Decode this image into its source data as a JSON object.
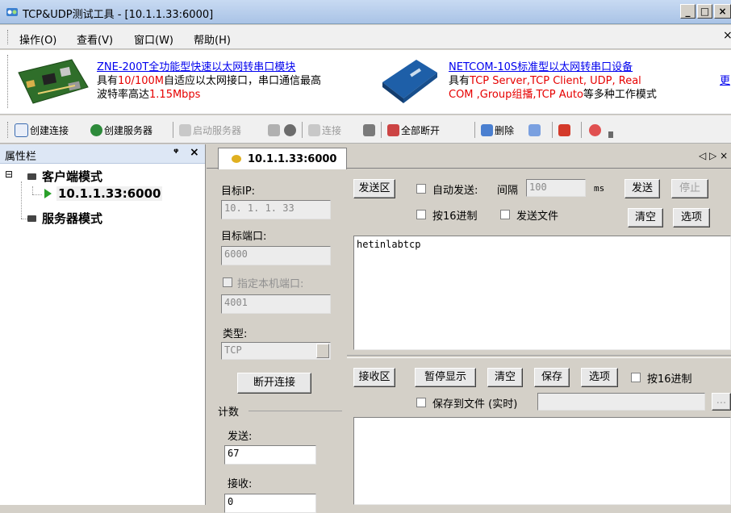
{
  "window": {
    "title": "TCP&UDP测试工具 - [10.1.1.33:6000]",
    "min_label": "_",
    "max_label": "□",
    "close_label": "×"
  },
  "menu": {
    "items": [
      "操作(O)",
      "查看(V)",
      "窗口(W)",
      "帮助(H)"
    ],
    "close_label": "×"
  },
  "ads": {
    "left": {
      "icon": "circuit-board-icon",
      "line1": "ZNE-200T全功能型快速以太网转串口模块",
      "line2_a": "具有",
      "line2_b": "10/100M",
      "line2_c": "自适应以太网接口，串口通信最高",
      "line3_a": "波特率高达",
      "line3_b": "1.15Mbps"
    },
    "right": {
      "icon": "serial-server-device-icon",
      "line1": "NETCOM-10S标准型以太网转串口设备",
      "line2_a": "具有",
      "line2_b": "TCP Server,TCP Client, UDP, Real",
      "line3_a": "COM ,Group组播,TCP Auto",
      "line3_b": "等多种工作模式"
    },
    "more_label": "更"
  },
  "toolbar": {
    "create_connection": "创建连接",
    "create_server": "创建服务器",
    "start_server": "启动服务器",
    "connect": "连接",
    "disconnect_all": "全部断开",
    "delete": "删除",
    "icons": [
      "new-connection-icon",
      "globe-server-icon",
      "start-server-icon",
      "server-icon",
      "stop-circle-icon",
      "connect-icon",
      "disconnect-icon",
      "disconnect-all-icon",
      "delete-icon",
      "settings-icon",
      "record-icon",
      "help-icon"
    ],
    "colors": {
      "accent_blue": "#1f5fbf",
      "delete_red": "#d43a2a"
    }
  },
  "properties": {
    "title": "属性栏",
    "pin_label": "ᵠ",
    "close_label": "×",
    "tree": {
      "client_mode": "客户端模式",
      "client_item": "10.1.1.33:6000",
      "server_mode": "服务器模式",
      "expander": "⊟"
    }
  },
  "tab": {
    "label": "10.1.1.33:6000",
    "nav_label": "◁ ▷ ×"
  },
  "config": {
    "target_ip_label": "目标IP:",
    "target_ip_value": "10. 1. 1. 33",
    "target_port_label": "目标端口:",
    "target_port_value": "6000",
    "local_port_label": "指定本机端口:",
    "local_port_value": "4001",
    "type_label": "类型:",
    "type_value": "TCP",
    "disconnect_button": "断开连接",
    "count_label": "计数",
    "sent_label": "发送:",
    "sent_value": "67",
    "recv_label": "接收:",
    "recv_value": "0"
  },
  "send": {
    "area_button": "发送区",
    "auto_send_label": "自动发送:",
    "interval_label": "间隔",
    "interval_value": "100",
    "ms_label": "ms",
    "send_button": "发送",
    "stop_button": "停止",
    "hex_label": "按16进制",
    "send_file_label": "发送文件",
    "clear_button": "清空",
    "options_button": "选项",
    "content": "hetinlabtcp"
  },
  "receive": {
    "area_button": "接收区",
    "pause_button": "暂停显示",
    "clear_button": "清空",
    "save_button": "保存",
    "options_button": "选项",
    "hex_label": "按16进制",
    "save_file_label": "保存到文件 (实时)",
    "browse_label": "...",
    "content": ""
  }
}
